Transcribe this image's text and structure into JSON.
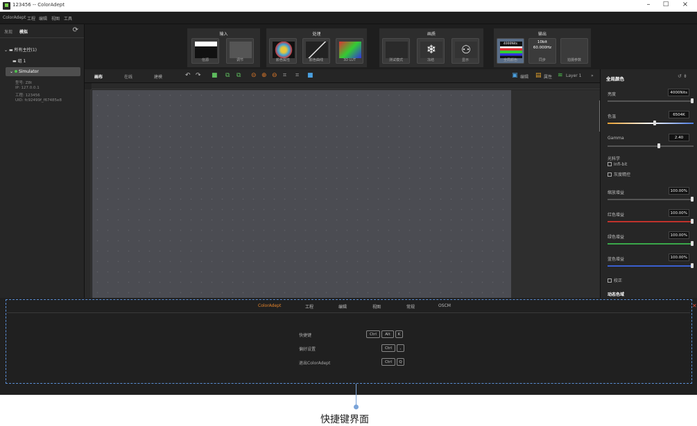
{
  "titlebar": {
    "title": "123456 -- ColorAdept",
    "min": "–",
    "max": "□",
    "close": "×"
  },
  "menubar": {
    "items": [
      "ColorAdept",
      "工程",
      "编辑",
      "视图",
      "工具"
    ]
  },
  "sidebar": {
    "tabs": [
      "发现",
      "模拟"
    ],
    "tree_root": "所有主控(1)",
    "group": "组 1",
    "device": "Simulator",
    "info": [
      "型号: Z8t",
      "IP: 127.0.0.1",
      "工程: 123456",
      "UID: fc92499f_f67485e8"
    ]
  },
  "ribbon": {
    "groups": [
      {
        "title": "输入",
        "tiles": [
          "信源",
          "调节"
        ]
      },
      {
        "title": "处理",
        "tiles": [
          "颜色属性",
          "颜色曲线",
          "3D LUT"
        ]
      },
      {
        "title": "画质",
        "tiles": [
          "测试模式",
          "冻结",
          "显示"
        ]
      },
      {
        "title": "输出",
        "tiles": [
          "全局颜色",
          "同步",
          "拍摄参数"
        ],
        "hdr": "4000Nits",
        "bitdepth": "10bit",
        "rate": "60.000Hz"
      }
    ]
  },
  "toolbar": {
    "tabs": [
      "画布",
      "在线",
      "建模"
    ],
    "edit_label": "编辑",
    "props_label": "属性",
    "layer_label": "Layer 1",
    "more": "»"
  },
  "right_panel": {
    "title": "全局颜色",
    "brightness": {
      "label": "亮度",
      "value": "4000Nits",
      "level": 1.0
    },
    "colortemp": {
      "label": "色温",
      "value": "6504K",
      "level": 0.55
    },
    "gamma": {
      "label": "Gamma",
      "value": "2.40",
      "level": 0.6
    },
    "optics_label": "光科学",
    "check_infibit": "Infi-bit",
    "check_gray": "灰度精控",
    "gain": {
      "label": "缩放增益",
      "value": "100.00%",
      "level": 1.0
    },
    "red_gain": {
      "label": "红色增益",
      "value": "100.00%",
      "level": 1.0
    },
    "green_gain": {
      "label": "绿色增益",
      "value": "100.00%",
      "level": 1.0
    },
    "blue_gain": {
      "label": "蓝色增益",
      "value": "100.00%",
      "level": 1.0
    },
    "correction": "校正",
    "dynamic": "动态色域",
    "colors": {
      "red": "#c0322c",
      "green": "#3aa84a",
      "blue": "#3a5fd0"
    }
  },
  "bottom": {
    "tabs": [
      "ColorAdept",
      "工程",
      "编辑",
      "视图",
      "常规",
      "OSCM"
    ],
    "shortcuts": [
      {
        "label": "快捷键",
        "keys": [
          "Ctrl",
          "Alt",
          "K"
        ]
      },
      {
        "label": "偏好设置",
        "keys": [
          "Ctrl",
          ","
        ]
      },
      {
        "label": "退出ColorAdept",
        "keys": [
          "Ctrl",
          "Q"
        ]
      }
    ],
    "close": "✕"
  },
  "caption": "快捷键界面"
}
